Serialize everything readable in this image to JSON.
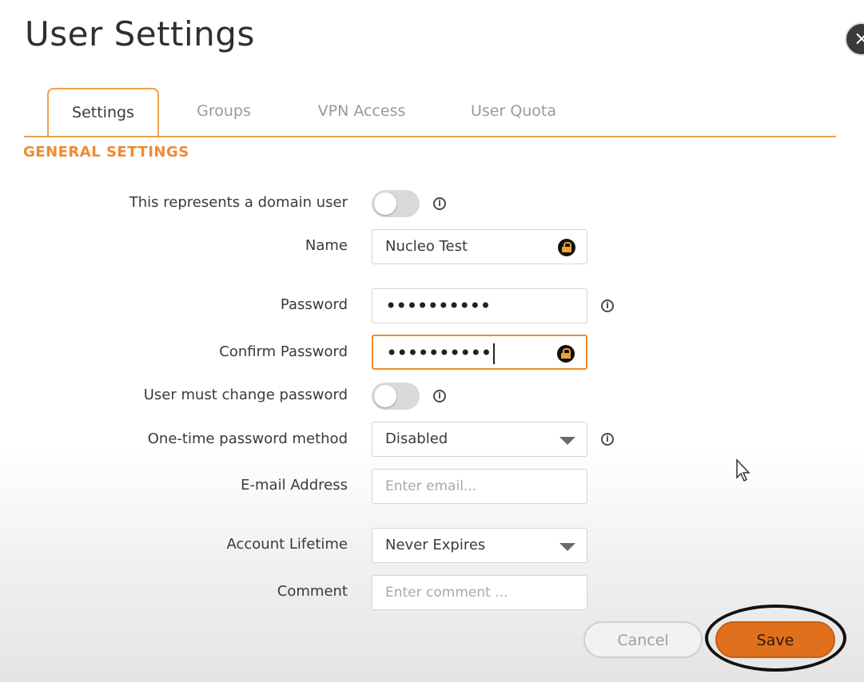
{
  "dialog": {
    "title": "User Settings",
    "close_glyph": "×"
  },
  "tabs": [
    {
      "label": "Settings",
      "active": true
    },
    {
      "label": "Groups",
      "active": false
    },
    {
      "label": "VPN Access",
      "active": false
    },
    {
      "label": "User Quota",
      "active": false
    }
  ],
  "section": {
    "title": "GENERAL SETTINGS"
  },
  "form": {
    "domain_user": {
      "label": "This represents a domain user",
      "on": false
    },
    "name": {
      "label": "Name",
      "value": "Nucleo Test"
    },
    "password": {
      "label": "Password",
      "value": "••••••••••"
    },
    "confirm_password": {
      "label": "Confirm Password",
      "value": "••••••••••"
    },
    "must_change": {
      "label": "User must change password",
      "on": false
    },
    "otp_method": {
      "label": "One-time password method",
      "value": "Disabled"
    },
    "email": {
      "label": "E-mail Address",
      "placeholder": "Enter email..."
    },
    "lifetime": {
      "label": "Account Lifetime",
      "value": "Never Expires"
    },
    "comment": {
      "label": "Comment",
      "placeholder": "Enter comment ..."
    }
  },
  "info_glyph": "i",
  "buttons": {
    "cancel": "Cancel",
    "save": "Save"
  },
  "colors": {
    "accent": "#ef8a30",
    "save_button": "#e0701c"
  }
}
